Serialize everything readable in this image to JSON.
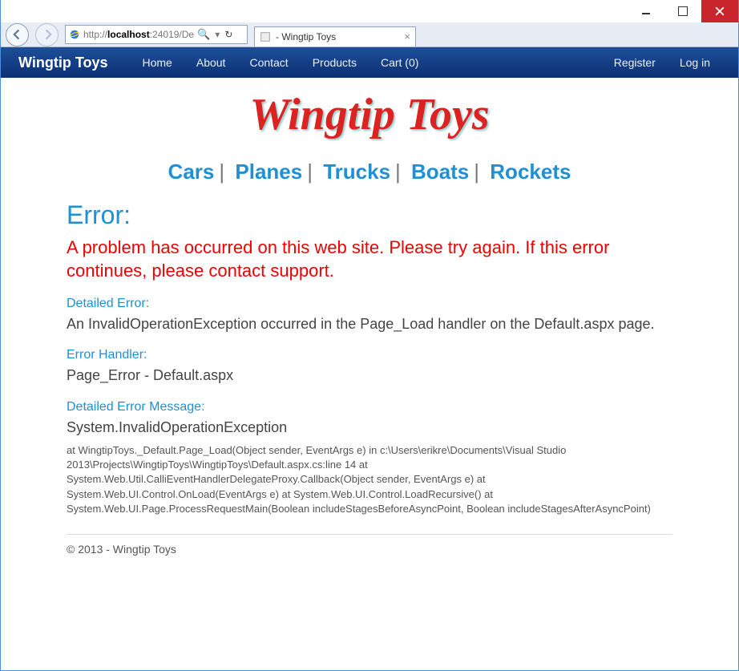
{
  "window": {
    "url_prefix": "http://",
    "url_host": "localhost",
    "url_rest": ":24019/De",
    "tab_title": " - Wingtip Toys"
  },
  "nav": {
    "brand": "Wingtip Toys",
    "links": {
      "home": "Home",
      "about": "About",
      "contact": "Contact",
      "products": "Products",
      "cart": "Cart (0)"
    },
    "account": {
      "register": "Register",
      "login": "Log in"
    }
  },
  "logo_text": "Wingtip Toys",
  "categories": [
    "Cars",
    "Planes",
    "Trucks",
    "Boats",
    "Rockets"
  ],
  "error": {
    "title": "Error:",
    "main": "A problem has occurred on this web site. Please try again. If this error continues, please contact support.",
    "detailed_label": "Detailed Error:",
    "detailed_text": "An InvalidOperationException occurred in the Page_Load handler on the Default.aspx page.",
    "handler_label": "Error Handler:",
    "handler_text": "Page_Error - Default.aspx",
    "msg_label": "Detailed Error Message:",
    "msg_text": "System.InvalidOperationException",
    "stack": "at WingtipToys._Default.Page_Load(Object sender, EventArgs e) in c:\\Users\\erikre\\Documents\\Visual Studio 2013\\Projects\\WingtipToys\\WingtipToys\\Default.aspx.cs:line 14 at System.Web.Util.CalliEventHandlerDelegateProxy.Callback(Object sender, EventArgs e) at System.Web.UI.Control.OnLoad(EventArgs e) at System.Web.UI.Control.LoadRecursive() at System.Web.UI.Page.ProcessRequestMain(Boolean includeStagesBeforeAsyncPoint, Boolean includeStagesAfterAsyncPoint)"
  },
  "footer": "© 2013 - Wingtip Toys"
}
